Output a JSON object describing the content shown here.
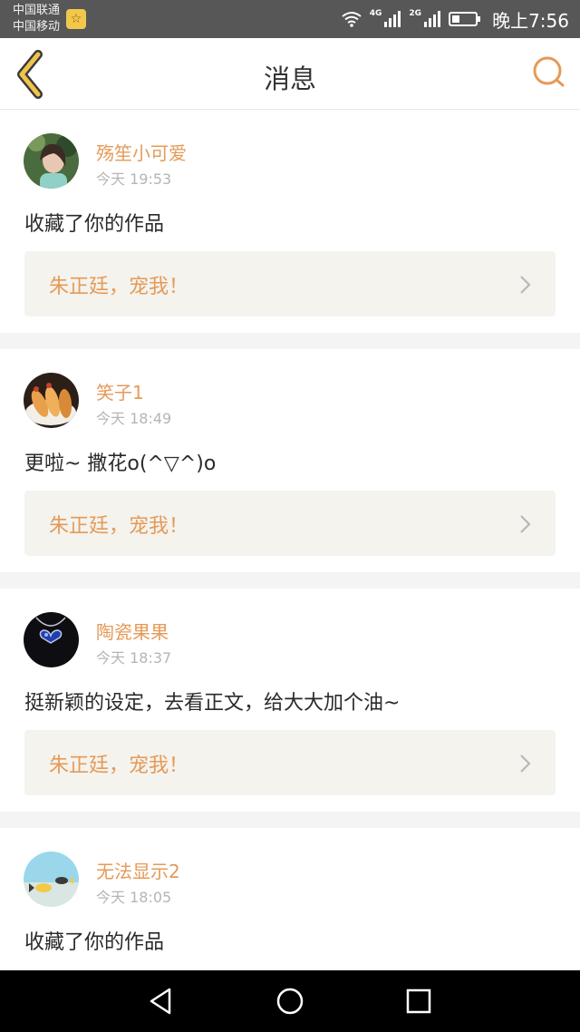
{
  "status_bar": {
    "carrier_1": "中国联通",
    "carrier_2": "中国移动",
    "network_1": "4G",
    "network_2": "2G",
    "time": "晚上7:56"
  },
  "header": {
    "title": "消息",
    "back_icon": "back-chevron-icon",
    "search_icon": "search-icon"
  },
  "messages": [
    {
      "user": "殇笙小可爱",
      "time": "今天 19:53",
      "text": "收藏了你的作品",
      "work": "朱正廷，宠我！"
    },
    {
      "user": "笑子1",
      "time": "今天 18:49",
      "text": "更啦~ 撒花o(^▽^)o",
      "work": "朱正廷，宠我！"
    },
    {
      "user": "陶瓷果果",
      "time": "今天 18:37",
      "text": "挺新颖的设定，去看正文，给大大加个油~",
      "work": "朱正廷，宠我！"
    },
    {
      "user": "无法显示2",
      "time": "今天 18:05",
      "text": "收藏了你的作品"
    }
  ],
  "colors": {
    "accent": "#e59a58",
    "back_icon": "#f0c34b",
    "status_bar": "#575757",
    "card_link_bg": "#f4f3ee"
  }
}
